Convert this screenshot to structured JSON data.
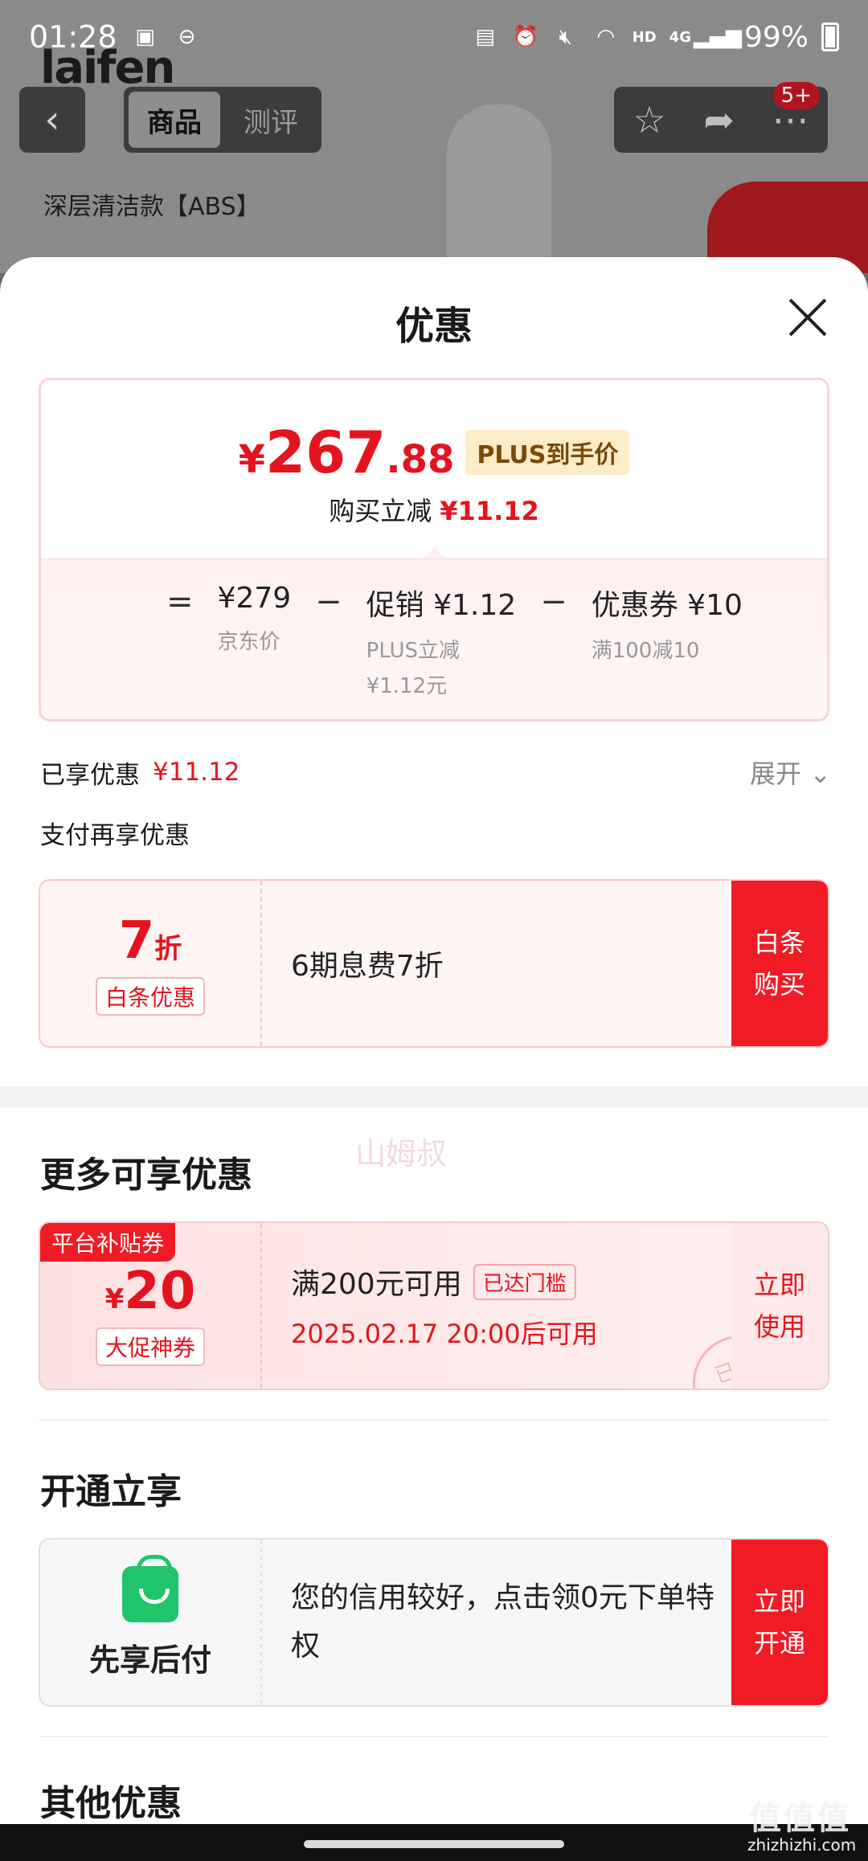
{
  "status_bar": {
    "time": "01:28",
    "network": "4G",
    "hd": "HD",
    "battery": "99%"
  },
  "background": {
    "logo": "laifen",
    "tabs": [
      {
        "label": "商品",
        "active": true
      },
      {
        "label": "测评",
        "active": false
      }
    ],
    "badge": "5+",
    "variant": "深层清洁款【ABS】"
  },
  "sheet": {
    "title": "优惠",
    "price_card": {
      "currency": "¥",
      "price_int": "267",
      "price_dec": ".88",
      "plus_tag": "PLUS到手价",
      "reduce_label": "购买立减",
      "reduce_value": "¥11.12",
      "formula": {
        "eq": "=",
        "minus": "−",
        "jd_price": "¥279",
        "jd_label": "京东价",
        "promo_head": "促销",
        "promo_value": "¥1.12",
        "promo_sub1": "PLUS立减",
        "promo_sub2": "¥1.12元",
        "coupon_head": "优惠券",
        "coupon_value": "¥10",
        "coupon_sub": "满100减10"
      }
    },
    "enjoyed": {
      "label": "已享优惠",
      "value": "¥11.12",
      "expand": "展开"
    },
    "pay_title": "支付再享优惠",
    "baitiao": {
      "discount_num": "7",
      "discount_unit": "折",
      "tag": "白条优惠",
      "desc": "6期息费7折",
      "action": "白条购买"
    },
    "more_title": "更多可享优惠",
    "platform_coupon": {
      "corner": "平台补贴券",
      "currency": "¥",
      "amount": "20",
      "tag": "大促神券",
      "condition": "满200元可用",
      "reached": "已达门槛",
      "time": "2025.02.17 20:00后可用",
      "stamp": "已领",
      "action": "立即使用"
    },
    "open_title": "开通立享",
    "credit": {
      "label": "先享后付",
      "desc": "您的信用较好，点击领0元下单特权",
      "action": "立即开通"
    },
    "other_title": "其他优惠"
  },
  "watermark": {
    "main": "值值值",
    "sub": "zhizhizhi.com",
    "faint": "山姆叔"
  },
  "colors": {
    "accent_red": "#e4141e",
    "button_red": "#f01b25",
    "plus_bg": "#fdecc8",
    "green": "#1fc46c"
  }
}
